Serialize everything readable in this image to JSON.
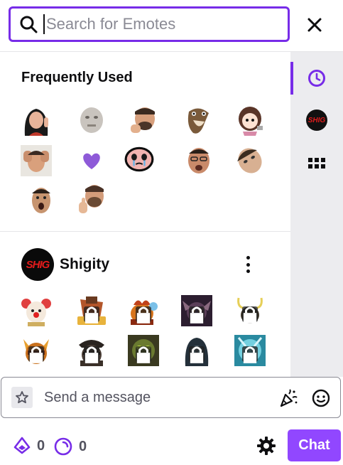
{
  "search": {
    "placeholder": "Search for Emotes"
  },
  "frequently_used": {
    "title": "Frequently Used",
    "emotes": [
      {
        "icon": "woman-face-emote"
      },
      {
        "icon": "blurry-face-emote"
      },
      {
        "icon": "thinking-man-emote"
      },
      {
        "icon": "snake-emote"
      },
      {
        "icon": "cartoon-girl-emote"
      },
      {
        "icon": "stressed-man-emote"
      },
      {
        "icon": "purple-heart-emote"
      },
      {
        "icon": "isaac-crying-emote"
      },
      {
        "icon": "angry-man-emote"
      },
      {
        "icon": "tilted-face-emote"
      },
      {
        "icon": "shocked-man-emote"
      },
      {
        "icon": "thumbs-up-man-emote"
      }
    ]
  },
  "channel": {
    "logo_text": "SHIG",
    "name": "Shigity",
    "emotes": [
      {
        "icon": "clown-emote",
        "locked": false
      },
      {
        "icon": "bonk-emote",
        "locked": true
      },
      {
        "icon": "fire-heart-emote",
        "locked": true
      },
      {
        "icon": "dark-creature-emote",
        "locked": true
      },
      {
        "icon": "yellow-horns-emote",
        "locked": true
      },
      {
        "icon": "helmet-emote",
        "locked": true
      },
      {
        "icon": "pirate-emote",
        "locked": true
      },
      {
        "icon": "green-emote",
        "locked": true
      },
      {
        "icon": "hooded-emote",
        "locked": true
      },
      {
        "icon": "ice-emote",
        "locked": true
      }
    ]
  },
  "sidebar": {
    "shig_logo_text": "SHIG"
  },
  "chat": {
    "placeholder": "Send a message",
    "send_label": "Chat"
  },
  "bottom": {
    "bits_count": "0",
    "points_count": "0"
  },
  "colors": {
    "accent": "#772ce8",
    "button": "#9147ff"
  }
}
